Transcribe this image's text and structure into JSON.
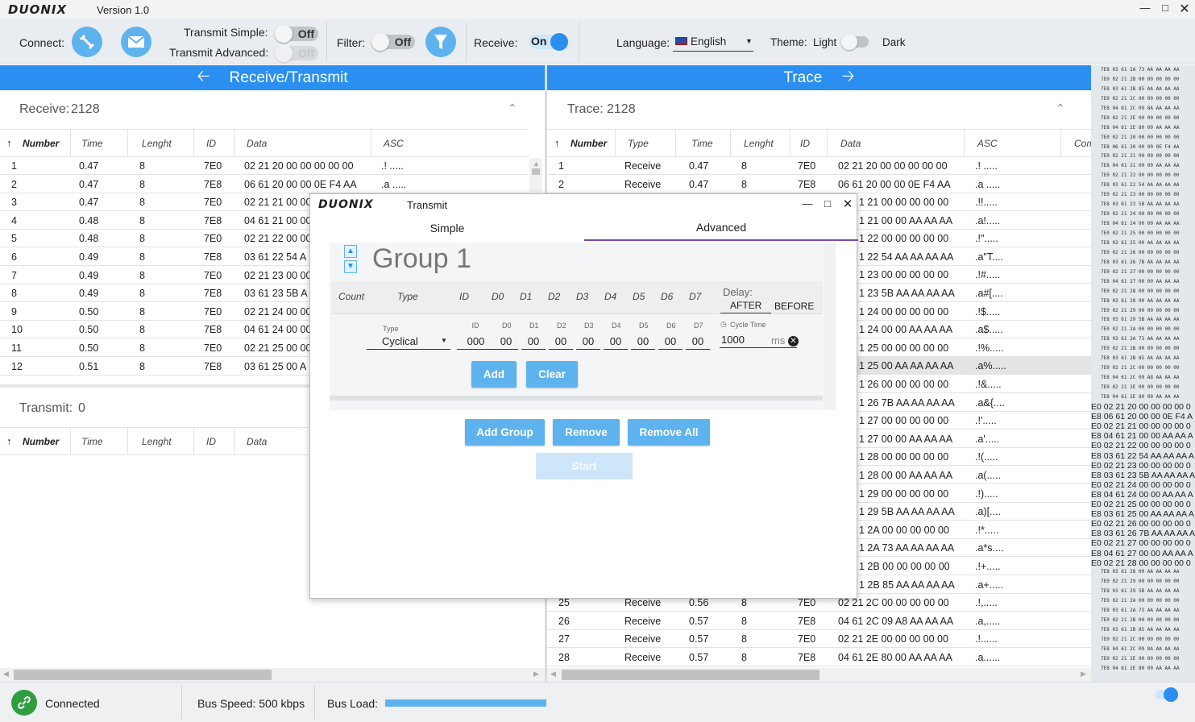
{
  "app": {
    "logo": "DUONIX",
    "version": "Version 1.0"
  },
  "toolbar": {
    "connect_label": "Connect:",
    "transmit_simple_label": "Transmit Simple:",
    "transmit_simple_state": "Off",
    "transmit_advanced_label": "Transmit Advanced:",
    "transmit_advanced_state": "Off",
    "filter_label": "Filter:",
    "filter_state": "Off",
    "receive_label": "Receive:",
    "receive_state": "On",
    "language_label": "Language:",
    "language_value": "English",
    "theme_label": "Theme:",
    "theme_light": "Light",
    "theme_dark": "Dark",
    "accent": "#2a8ff0",
    "button_color": "#5eb3ee"
  },
  "left_panel": {
    "title": "Receive/Transmit",
    "receive_label": "Receive:",
    "receive_count": "2128",
    "columns": [
      "Number",
      "Time",
      "Lenght",
      "ID",
      "Data",
      "ASC"
    ],
    "rows": [
      [
        "1",
        "0.47",
        "8",
        "7E0",
        "02 21 20 00 00 00 00 00",
        ".! ....."
      ],
      [
        "2",
        "0.47",
        "8",
        "7E8",
        "06 61 20 00 00 0E F4 AA",
        ".a ....."
      ],
      [
        "3",
        "0.47",
        "8",
        "7E0",
        "02 21 21 00 00",
        ""
      ],
      [
        "4",
        "0.48",
        "8",
        "7E8",
        "04 61 21 00 00",
        ""
      ],
      [
        "5",
        "0.48",
        "8",
        "7E0",
        "02 21 22 00 00",
        ""
      ],
      [
        "6",
        "0.49",
        "8",
        "7E8",
        "03 61 22 54 A",
        ""
      ],
      [
        "7",
        "0.49",
        "8",
        "7E0",
        "02 21 23 00 00",
        ""
      ],
      [
        "8",
        "0.49",
        "8",
        "7E8",
        "03 61 23 5B A",
        ""
      ],
      [
        "9",
        "0.50",
        "8",
        "7E0",
        "02 21 24 00 00",
        ""
      ],
      [
        "10",
        "0.50",
        "8",
        "7E8",
        "04 61 24 00 00",
        ""
      ],
      [
        "11",
        "0.50",
        "8",
        "7E0",
        "02 21 25 00 00",
        ""
      ],
      [
        "12",
        "0.51",
        "8",
        "7E8",
        "03 61 25 00 A",
        ""
      ]
    ],
    "transmit_label": "Transmit:",
    "transmit_count": "0",
    "transmit_columns": [
      "Number",
      "Time",
      "Lenght",
      "ID",
      "Data"
    ]
  },
  "right_panel": {
    "title": "Trace",
    "trace_label": "Trace:",
    "trace_count": "2128",
    "columns": [
      "Number",
      "Type",
      "Time",
      "Lenght",
      "ID",
      "Data",
      "ASC",
      "Com"
    ],
    "rows_top": [
      [
        "1",
        "Receive",
        "0.47",
        "8",
        "7E0",
        "02 21 20 00 00 00 00 00",
        ".! ....."
      ],
      [
        "2",
        "Receive",
        "0.47",
        "8",
        "7E8",
        "06 61 20 00 00 0E F4 AA",
        ".a ....."
      ]
    ],
    "rows_partial": [
      [
        "1 21 00 00 00 00 00",
        ".!!....."
      ],
      [
        "1 21 00 00 AA AA AA",
        ".a!....."
      ],
      [
        "1 22 00 00 00 00 00",
        ".!\"....."
      ],
      [
        "1 22 54 AA AA AA AA",
        ".a\"T...."
      ],
      [
        "1 23 00 00 00 00 00",
        ".!#....."
      ],
      [
        "1 23 5B AA AA AA AA",
        ".a#[...."
      ],
      [
        "1 24 00 00 00 00 00",
        ".!$....."
      ],
      [
        "1 24 00 00 AA AA AA",
        ".a$....."
      ],
      [
        "1 25 00 00 00 00 00",
        ".!%....."
      ],
      [
        "1 25 00 AA AA AA AA",
        ".a%....."
      ],
      [
        "1 26 00 00 00 00 00",
        ".!&....."
      ],
      [
        "1 26 7B AA AA AA AA",
        ".a&{...."
      ],
      [
        "1 27 00 00 00 00 00",
        ".!'....."
      ],
      [
        "1 27 00 00 AA AA AA",
        ".a'....."
      ],
      [
        "1 28 00 00 00 00 00",
        ".!(....."
      ],
      [
        "1 28 00 00 AA AA AA",
        ".a(....."
      ],
      [
        "1 29 00 00 00 00 00",
        ".!)....."
      ],
      [
        "1 29 5B AA AA AA AA",
        ".a)[...."
      ],
      [
        "1 2A 00 00 00 00 00",
        ".!*....."
      ],
      [
        "1 2A 73 AA AA AA AA",
        ".a*s...."
      ],
      [
        "1 2B 00 00 00 00 00",
        ".!+....."
      ],
      [
        "1 2B 85 AA AA AA AA",
        ".a+....."
      ]
    ],
    "rows_bottom": [
      [
        "25",
        "Receive",
        "0.56",
        "8",
        "7E0",
        "02 21 2C 00 00 00 00 00",
        ".!,....."
      ],
      [
        "26",
        "Receive",
        "0.57",
        "8",
        "7E8",
        "04 61 2C 09 A8 AA AA AA",
        ".a,....."
      ],
      [
        "27",
        "Receive",
        "0.57",
        "8",
        "7E0",
        "02 21 2E 00 00 00 00 00",
        ".!......"
      ],
      [
        "28",
        "Receive",
        "0.57",
        "8",
        "7E8",
        "04 61 2E 80 00 AA AA AA",
        ".a......"
      ]
    ]
  },
  "trace_strip": {
    "small_top": [
      "7E8 03 61 2A 73 AA AA AA AA",
      "7E0 02 21 2B 00 00 00 00 00",
      "7E8 03 61 2B 85 AA AA AA AA",
      "7E0 02 21 2C 00 00 00 00 00",
      "7E8 04 61 2C 09 8A AA AA AA",
      "7E0 02 21 2E 00 00 00 00 00",
      "7E8 04 61 2E 80 00 AA AA AA",
      "7E0 02 21 20 00 00 00 00 00",
      "7E8 06 61 20 00 00 0E F4 AA",
      "7E0 02 21 21 00 00 00 00 00",
      "7E8 04 61 21 00 00 AA AA AA",
      "7E0 02 21 22 00 00 00 00 00",
      "7E8 03 61 22 54 AA AA AA AA",
      "7E0 02 21 23 00 00 00 00 00",
      "7E8 03 61 23 5B AA AA AA AA",
      "7E0 02 21 24 00 00 00 00 00",
      "7E8 04 61 24 00 00 AA AA AA",
      "7E0 02 21 25 00 00 00 00 00",
      "7E8 03 61 25 00 AA AA AA AA",
      "7E0 02 21 26 00 00 00 00 00",
      "7E8 03 61 26 7B AA AA AA AA",
      "7E0 02 21 27 00 00 00 00 00",
      "7E8 04 61 27 00 00 AA AA AA",
      "7E0 02 21 28 00 00 00 00 00",
      "7E8 03 61 28 00 AA AA AA AA",
      "7E0 02 21 29 00 00 00 00 00",
      "7E8 03 61 29 5B AA AA AA AA",
      "7E0 02 21 2A 00 00 00 00 00",
      "7E8 03 61 2A 73 AA AA AA AA",
      "7E0 02 21 2B 00 00 00 00 00",
      "7E8 03 61 2B 85 AA AA AA AA",
      "7E0 02 21 2C 00 00 00 00 00",
      "7E8 04 61 2C 09 A8 AA AA AA",
      "7E0 02 21 2E 00 00 00 00 00",
      "7E8 04 61 2E 80 00 AA AA AA"
    ],
    "large": [
      "E0 02 21 20 00 00 00 00 0",
      "E8 06 61 20 00 00 0E F4 A",
      "E0 02 21 21 00 00 00 00 0",
      "E8 04 61 21 00 00 AA AA A",
      "E0 02 21 22 00 00 00 00 0",
      "E8 03 61 22 54 AA AA AA A",
      "E0 02 21 23 00 00 00 00 0",
      "E8 03 61 23 5B AA AA AA A",
      "E0 02 21 24 00 00 00 00 0",
      "E8 04 61 24 00 00 AA AA A",
      "E0 02 21 25 00 00 00 00 0",
      "E8 03 61 25 00 AA AA AA A",
      "E0 02 21 26 00 00 00 00 0",
      "E8 03 61 26 7B AA AA AA A",
      "E0 02 21 27 00 00 00 00 0",
      "E8 04 61 27 00 00 AA AA A",
      "E0 02 21 28 00 00 00 00 0"
    ],
    "small_bottom": [
      "7E8 03 61 28 00 AA AA AA AA",
      "7E0 02 21 29 00 00 00 00 00",
      "7E8 03 61 29 5B AA AA AA AA",
      "7E0 02 21 2A 00 00 00 00 00",
      "7E8 03 61 2A 73 AA AA AA AA",
      "7E0 02 21 2B 00 00 00 00 00",
      "7E8 03 61 2B 85 AA AA AA AA",
      "7E0 02 21 2C 00 00 00 00 00",
      "7E8 04 61 2C 09 8A AA AA AA",
      "7E0 02 21 2E 00 00 00 00 00",
      "7E8 04 61 2E 80 00 AA AA AA"
    ]
  },
  "modal": {
    "logo": "DUONIX",
    "title": "Transmit",
    "tab_simple": "Simple",
    "tab_advanced": "Advanced",
    "group_title": "Group 1",
    "columns": [
      "Count",
      "Type",
      "ID",
      "D0",
      "D1",
      "D2",
      "D3",
      "D4",
      "D5",
      "D6",
      "D7"
    ],
    "delay_label": "Delay:",
    "delay_after": "AFTER",
    "delay_before": "BEFORE",
    "field_labels": {
      "type": "Type",
      "id": "ID",
      "d0": "D0",
      "d1": "D1",
      "d2": "D2",
      "d3": "D3",
      "d4": "D4",
      "d5": "D5",
      "d6": "D6",
      "d7": "D7",
      "cycle": "Cycle Time"
    },
    "values": {
      "type": "Cyclical",
      "id": "000",
      "d": [
        "00",
        "00",
        "00",
        "00",
        "00",
        "00",
        "00",
        "00"
      ],
      "cycle": "1000",
      "unit": "ms"
    },
    "add": "Add",
    "clear": "Clear",
    "add_group": "Add Group",
    "remove": "Remove",
    "remove_all": "Remove All",
    "start": "Start"
  },
  "status": {
    "connection": "Connected",
    "bus_speed": "Bus Speed: 500 kbps",
    "bus_load_label": "Bus Load:",
    "bus_load_fraction": 1.0
  }
}
